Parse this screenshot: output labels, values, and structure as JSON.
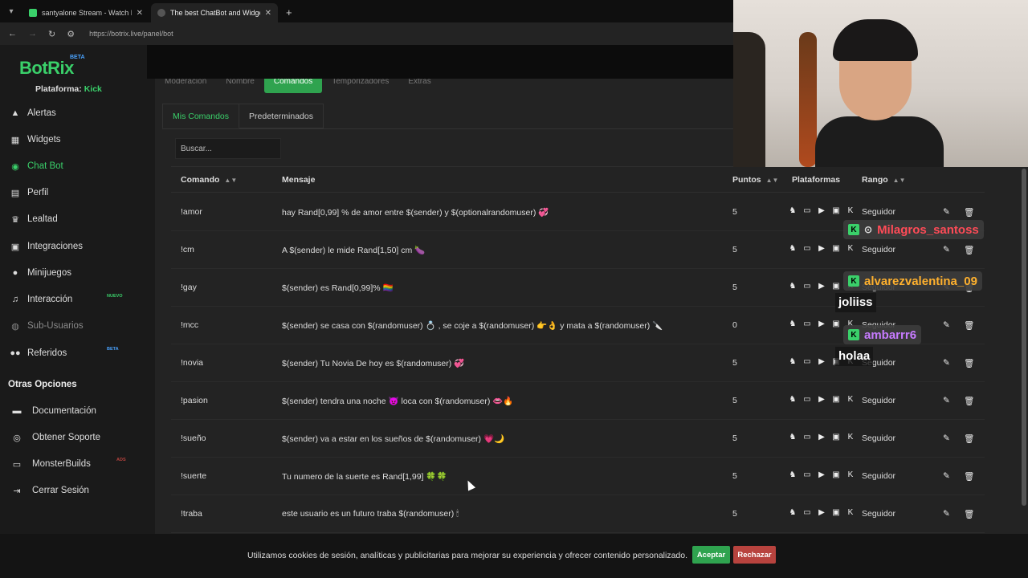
{
  "browser": {
    "tabs": [
      {
        "title": "santyalone Stream - Watch Live",
        "favicon_color": "#3ad06a"
      },
      {
        "title": "The best ChatBot and Widgets",
        "favicon_color": "#2b2b2b"
      }
    ],
    "new_tab": "+",
    "url": "https://botrix.live/panel/bot"
  },
  "brand": {
    "name": "BotRix",
    "badge": "BETA"
  },
  "platform": {
    "label": "Plataforma:",
    "value": "Kick"
  },
  "sidebar": {
    "items": [
      {
        "label": "Alertas",
        "icon": "warning-icon"
      },
      {
        "label": "Widgets",
        "icon": "grid-icon"
      },
      {
        "label": "Chat Bot",
        "icon": "robot-icon",
        "active": true
      },
      {
        "label": "Perfil",
        "icon": "id-card-icon"
      },
      {
        "label": "Lealtad",
        "icon": "trophy-icon"
      },
      {
        "label": "Integraciones",
        "icon": "server-icon"
      },
      {
        "label": "Minijuegos",
        "icon": "gamepad-icon"
      },
      {
        "label": "Interacción",
        "icon": "music-icon",
        "tag": "NUEVO"
      },
      {
        "label": "Sub-Usuarios",
        "icon": "user-cog-icon",
        "muted": true
      },
      {
        "label": "Referidos",
        "icon": "users-icon",
        "tag": "BETA"
      }
    ],
    "other_title": "Otras Opciones",
    "other_items": [
      {
        "label": "Documentación",
        "icon": "book-icon"
      },
      {
        "label": "Obtener Soporte",
        "icon": "lifebuoy-icon"
      },
      {
        "label": "MonsterBuilds",
        "icon": "monitor-icon",
        "tag": "ADS"
      },
      {
        "label": "Cerrar Sesión",
        "icon": "logout-icon"
      }
    ]
  },
  "top_tabs": [
    "Moderación",
    "Nombre",
    "Comandos",
    "Temporizadores",
    "Extras"
  ],
  "sub_tabs": [
    "Mis Comandos",
    "Predeterminados"
  ],
  "search": {
    "placeholder": "Buscar..."
  },
  "table": {
    "headers": [
      "Comando",
      "Mensaje",
      "Puntos",
      "Plataformas",
      "Rango"
    ],
    "rows": [
      {
        "command": "!amor",
        "message": "hay Rand[0,99] % de amor entre $(sender) y $(optionalrandomuser) 💞",
        "points": "5",
        "rank": "Seguidor"
      },
      {
        "command": "!cm",
        "message": "A $(sender) le mide Rand[1,50] cm 🍆",
        "points": "5",
        "rank": "Seguidor"
      },
      {
        "command": "!gay",
        "message": "$(sender) es Rand[0,99]% 🏳️‍🌈",
        "points": "5",
        "rank": "Seguidor"
      },
      {
        "command": "!mcc",
        "message": "$(sender) se casa con $(randomuser) 💍 , se coje a $(randomuser) 👉👌 y mata a $(randomuser) 🔪",
        "points": "0",
        "rank": "Seguidor"
      },
      {
        "command": "!novia",
        "message": "$(sender) Tu Novia De hoy es $(randomuser) 💞",
        "points": "5",
        "rank": "Seguidor"
      },
      {
        "command": "!pasion",
        "message": "$(sender) tendra una noche 😈 loca con $(randomuser) 👄🔥",
        "points": "5",
        "rank": "Seguidor"
      },
      {
        "command": "!sueño",
        "message": "$(sender) va a estar en los sueños de $(randomuser) 💗🌙",
        "points": "5",
        "rank": "Seguidor"
      },
      {
        "command": "!suerte",
        "message": "Tu numero de la suerte es Rand[1,99] 🍀🍀",
        "points": "5",
        "rank": "Seguidor"
      },
      {
        "command": "!traba",
        "message": "este usuario es un futuro traba $(randomuser) 🕯",
        "points": "5",
        "rank": "Seguidor"
      }
    ],
    "platform_icons": [
      "kick-alt-icon",
      "twitch-icon",
      "youtube-icon",
      "trovo-icon",
      "kick-icon"
    ]
  },
  "overlay_chat": [
    {
      "user": "Milagros_santoss",
      "color": "#ff4b57",
      "message": ""
    },
    {
      "user": "alvarezvalentina_09",
      "color": "#ffb12e",
      "message": "joliiss"
    },
    {
      "user": "ambarrr6",
      "color": "#c77bff",
      "message": "holaa"
    }
  ],
  "cookie": {
    "text": "Utilizamos cookies de sesión, analíticas y publicitarias para mejorar su experiencia y ofrecer contenido personalizado.",
    "accept": "Aceptar",
    "reject": "Rechazar"
  }
}
